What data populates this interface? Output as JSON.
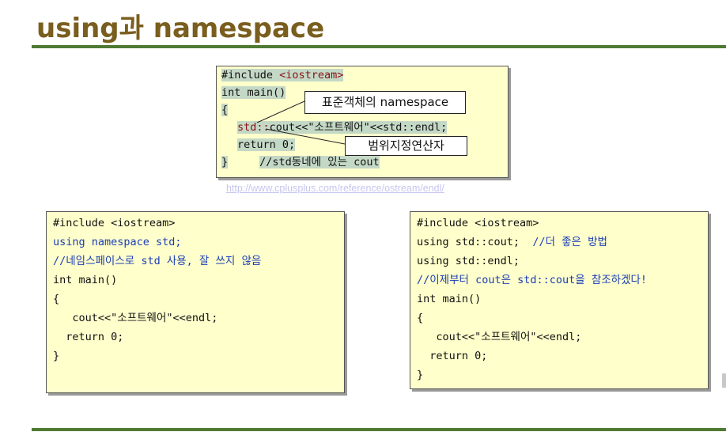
{
  "title": "using과 namespace",
  "top_code": {
    "line1_a": "#include ",
    "line1_b": "<iostream>",
    "line2": "int main()",
    "line3": "{",
    "line4_a": "std::",
    "line4_b": "cout<<\"소프트웨어\"<<std::endl;",
    "line5": "return 0;",
    "line6_a": "}",
    "line6_b": "//std동네에 있는 cout"
  },
  "callouts": {
    "std_object": "표준객체의 namespace",
    "scope_operator": "범위지정연산자"
  },
  "reference_link": "http://www.cplusplus.com/reference/ostream/endl/",
  "left_code": {
    "lines": [
      "#include <iostream>",
      "using namespace std;",
      "//네임스페이스로 std 사용, 잘 쓰지 않음",
      "int main()",
      "{",
      "   cout<<\"소프트웨어\"<<endl;",
      "  return 0;",
      "}"
    ]
  },
  "right_code": {
    "lines": [
      "#include <iostream>",
      "using std::cout;  ",
      "//더 좋은 방법",
      "using std::endl;",
      "//이제부터 cout은 std::cout을 참조하겠다!",
      "int main()",
      "{",
      "   cout<<\"소프트웨어\"<<endl;",
      "  return 0;",
      "}"
    ]
  },
  "colors": {
    "title": "#7a5e1e",
    "rule": "#4f7a33",
    "code_bg": "#ffffcc",
    "comment_blue": "#1a3db8",
    "link": "#c6c6f0"
  }
}
